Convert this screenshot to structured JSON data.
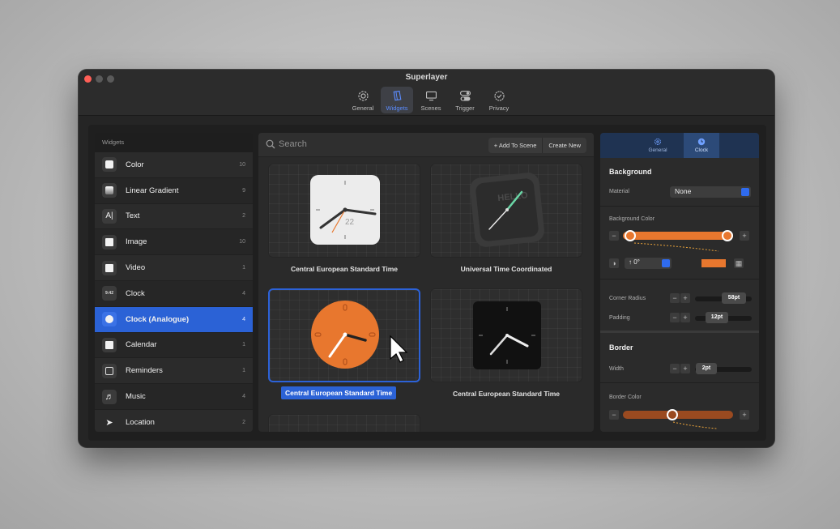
{
  "window": {
    "title": "Superlayer"
  },
  "toolbar": {
    "items": [
      {
        "label": "General",
        "icon": "gear-icon"
      },
      {
        "label": "Widgets",
        "icon": "widgets-icon",
        "active": true
      },
      {
        "label": "Scenes",
        "icon": "monitor-icon"
      },
      {
        "label": "Trigger",
        "icon": "toggle-icon"
      },
      {
        "label": "Privacy",
        "icon": "check-badge-icon"
      }
    ]
  },
  "sidebar": {
    "header": "Widgets",
    "items": [
      {
        "label": "Color",
        "count": "10",
        "icon": "color-swatch-icon"
      },
      {
        "label": "Linear Gradient",
        "count": "9",
        "icon": "gradient-icon"
      },
      {
        "label": "Text",
        "count": "2",
        "icon": "text-cursor-icon"
      },
      {
        "label": "Image",
        "count": "10",
        "icon": "image-icon"
      },
      {
        "label": "Video",
        "count": "1",
        "icon": "film-icon"
      },
      {
        "label": "Clock",
        "count": "4",
        "icon": "digital-clock-icon"
      },
      {
        "label": "Clock (Analogue)",
        "count": "4",
        "icon": "analog-clock-icon",
        "active": true
      },
      {
        "label": "Calendar",
        "count": "1",
        "icon": "calendar-icon"
      },
      {
        "label": "Reminders",
        "count": "1",
        "icon": "list-icon"
      },
      {
        "label": "Music",
        "count": "4",
        "icon": "music-note-icon"
      },
      {
        "label": "Location",
        "count": "2",
        "icon": "location-arrow-icon"
      }
    ]
  },
  "search": {
    "placeholder": "Search",
    "add_to_scene": "+ Add To Scene",
    "create_new": "Create New"
  },
  "widgets": [
    {
      "label": "Central European Standard Time"
    },
    {
      "label": "Universal Time Coordinated",
      "face_text": "HELLO"
    },
    {
      "label": "Central European Standard Time",
      "selected": true
    },
    {
      "label": "Central European Standard Time"
    }
  ],
  "clock_date": "22",
  "inspector": {
    "tabs": [
      {
        "label": "General",
        "icon": "gear-icon"
      },
      {
        "label": "Clock",
        "icon": "clock-icon",
        "active": true
      }
    ],
    "background": {
      "title": "Background",
      "material_label": "Material",
      "material_value": "None",
      "color_label": "Background Color",
      "color": "#e8772e",
      "angle": "↑ 0°"
    },
    "corner_radius_label": "Corner Radius",
    "corner_radius_value": "58pt",
    "padding_label": "Padding",
    "padding_value": "12pt",
    "border": {
      "title": "Border",
      "width_label": "Width",
      "width_value": "2pt",
      "color_label": "Border Color",
      "color": "#9a4a20"
    }
  },
  "colors": {
    "accent": "#2b62d6",
    "orange": "#e8772e"
  }
}
